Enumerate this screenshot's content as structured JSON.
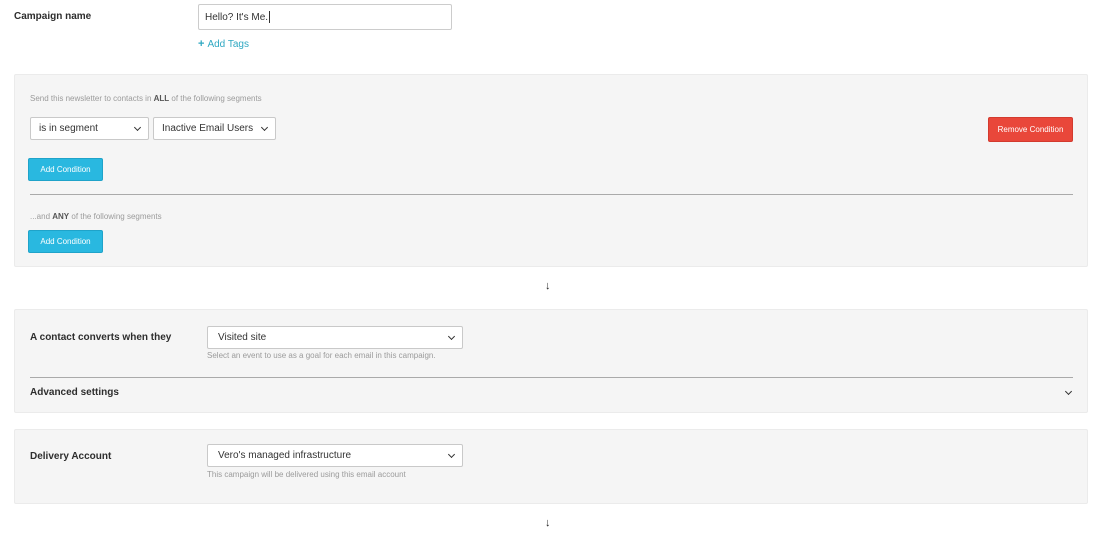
{
  "campaign": {
    "name_label": "Campaign name",
    "name_value": "Hello? It's Me.",
    "add_tags_label": "Add Tags"
  },
  "segments": {
    "all_hint_prefix": "Send this newsletter to contacts in ",
    "all_hint_keyword": "ALL",
    "all_hint_suffix": " of the following segments",
    "condition_operator": "is in segment",
    "condition_segment": "Inactive Email Users",
    "remove_condition_label": "Remove Condition",
    "add_condition_label": "Add Condition",
    "any_hint_prefix": "...and ",
    "any_hint_keyword": "ANY",
    "any_hint_suffix": " of the following segments",
    "add_condition_any_label": "Add Condition"
  },
  "conversion": {
    "label": "A contact converts when they",
    "event_value": "Visited site",
    "help": "Select an event to use as a goal for each email in this campaign.",
    "advanced_label": "Advanced settings"
  },
  "delivery": {
    "label": "Delivery Account",
    "account_value": "Vero's managed infrastructure",
    "help": "This campaign will be delivered using this email account"
  },
  "icons": {
    "flow_arrow": "↓"
  },
  "colors": {
    "accent_teal": "#2fa8c2",
    "button_blue": "#29b8e0",
    "button_red": "#e9473a",
    "panel_bg": "#f5f5f5"
  }
}
